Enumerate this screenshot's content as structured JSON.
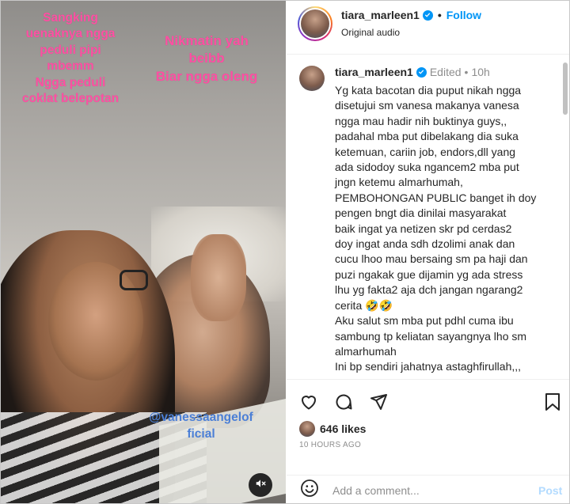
{
  "media": {
    "overlay_text_1": "Sangking\nuenaknya ngga\npeduli pipi\nmbemm\nNgga peduli\ncoklat belepotan",
    "overlay_text_2": "Nikmatin yah\nbeibb\nBiar ngga oleng",
    "mention_tag": "@vanessaangelof\nficial",
    "mute_icon": "speaker-muted-icon"
  },
  "header": {
    "username": "tiara_marleen1",
    "separator": "•",
    "follow_label": "Follow",
    "audio_label": "Original audio"
  },
  "caption": {
    "username": "tiara_marleen1",
    "edited_label": "Edited",
    "separator": "•",
    "age": "10h",
    "text": "Yg kata bacotan dia puput nikah ngga\ndisetujui sm vanesa makanya vanesa\nngga mau hadir nih buktinya guys,,\npadahal mba put dibelakang dia suka\nketemuan, cariin job, endors,dll yang\nada sidodoy suka ngancem2 mba put\njngn ketemu almarhumah,\nPEMBOHONGAN PUBLIC banget ih doy\npengen bngt dia dinilai masyarakat\nbaik ingat ya netizen skr pd cerdas2\ndoy ingat anda sdh dzolimi anak dan\ncucu lhoo mau bersaing sm pa haji dan\npuzi ngakak gue dijamin yg ada stress\nlhu yg fakta2 aja dch jangan ngarang2\ncerita 🤣🤣\nAku salut sm mba put pdhl cuma ibu\nsambung tp keliatan sayangnya lho sm\nalmarhumah\nIni bp sendiri jahatnya astaghfirullah,,,"
  },
  "actions": {
    "like_icon": "heart-icon",
    "comment_icon": "comment-icon",
    "share_icon": "send-icon",
    "save_icon": "bookmark-icon"
  },
  "likes": {
    "count_label": "646 likes",
    "timestamp": "10 HOURS AGO"
  },
  "comment": {
    "placeholder": "Add a comment...",
    "post_label": "Post"
  },
  "colors": {
    "overlay_pink": "#ff4fa3",
    "mention_blue": "#4b7fd6",
    "follow_blue": "#0095f6",
    "post_disabled": "#b3dbff"
  }
}
